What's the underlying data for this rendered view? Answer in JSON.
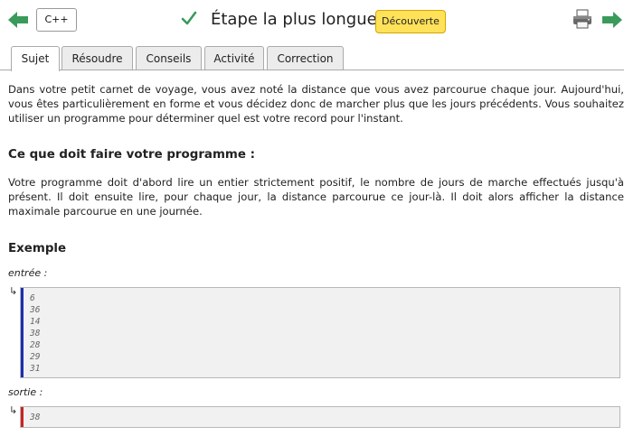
{
  "header": {
    "lang_button": "C++",
    "title": "Étape la plus longue",
    "badge": "Découverte",
    "colors": {
      "accent_green": "#3a9a5b",
      "badge_bg": "#ffe15a",
      "input_bar": "#1b2db3",
      "output_bar": "#cc2222"
    }
  },
  "tabs": [
    "Sujet",
    "Résoudre",
    "Conseils",
    "Activité",
    "Correction"
  ],
  "active_tab": "Sujet",
  "content": {
    "intro": "Dans votre petit carnet de voyage, vous avez noté la distance que vous avez parcourue chaque jour. Aujourd'hui, vous êtes particulièrement en forme et vous décidez donc de marcher plus que les jours précédents. Vous souhaitez utiliser un programme pour déterminer quel est votre record pour l'instant.",
    "section_title": "Ce que doit faire votre programme :",
    "section_text": "Votre programme doit d'abord lire un entier strictement positif, le nombre de jours de marche effectués jusqu'à présent. Il doit ensuite lire, pour chaque jour, la distance parcourue ce jour-là. Il doit alors afficher la distance maximale parcourue en une journée.",
    "example_title": "Exemple",
    "input_label": "entrée :",
    "output_label": "sortie :",
    "arrow_glyph": "↳",
    "input_lines": [
      "6",
      "36",
      "14",
      "38",
      "28",
      "29",
      "31"
    ],
    "output_lines": [
      "38"
    ]
  },
  "icons": [
    "arrow-left-icon",
    "check-icon",
    "printer-icon",
    "arrow-right-icon"
  ]
}
